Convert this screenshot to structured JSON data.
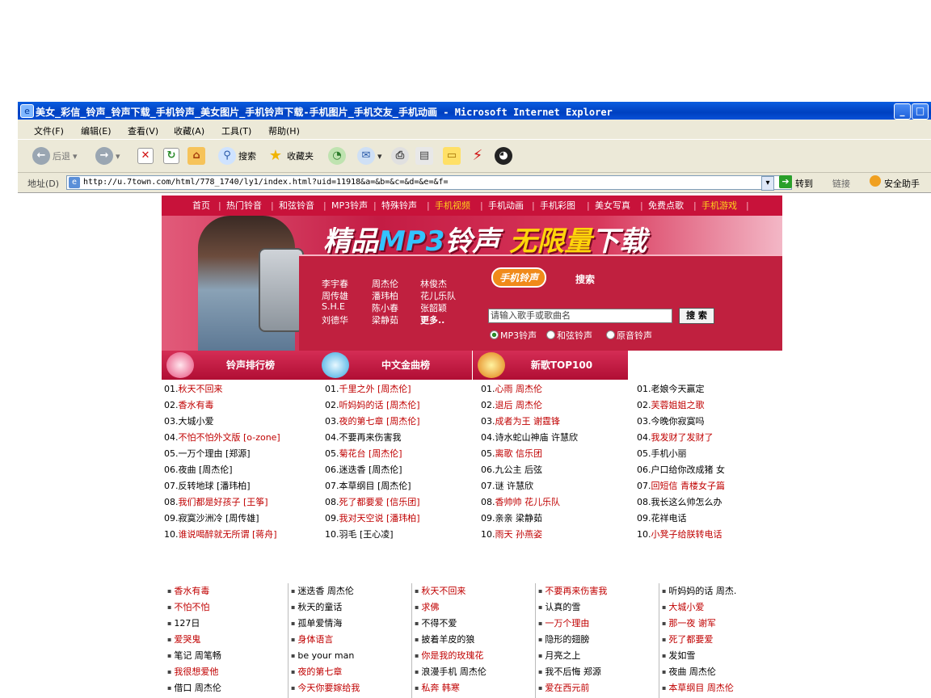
{
  "window": {
    "title": "美女_彩信_铃声_铃声下载_手机铃声_美女图片_手机铃声下载-手机图片_手机交友_手机动画 - Microsoft Internet Explorer"
  },
  "menu": [
    "文件(F)",
    "编辑(E)",
    "查看(V)",
    "收藏(A)",
    "工具(T)",
    "帮助(H)"
  ],
  "toolbar": {
    "back": "后退",
    "search": "搜索",
    "favorites": "收藏夹"
  },
  "address": {
    "label": "地址(D)",
    "url": "http://u.7town.com/html/778_1740/ly1/index.html?uid=11918&a=&b=&c=&d=&e=&f=",
    "go": "转到",
    "links": "链接",
    "assistant": "安全助手"
  },
  "nav": [
    {
      "label": "首页",
      "hl": false
    },
    {
      "label": "热门铃音",
      "hl": false
    },
    {
      "label": "和弦铃音",
      "hl": false
    },
    {
      "label": "MP3铃声",
      "hl": false
    },
    {
      "label": "特殊铃声",
      "hl": false
    },
    {
      "label": "手机视频",
      "hl": true
    },
    {
      "label": "手机动画",
      "hl": false
    },
    {
      "label": "手机彩图",
      "hl": false
    },
    {
      "label": "美女写真",
      "hl": false
    },
    {
      "label": "免费点歌",
      "hl": false
    },
    {
      "label": "手机游戏",
      "hl": true
    }
  ],
  "banner": {
    "headline_a": "精品",
    "headline_b": "MP3",
    "headline_c": "铃声",
    "headline_d": "无限量",
    "headline_e": "下载",
    "search_badge": "手机铃声",
    "search_word": "搜索",
    "search_placeholder": "请输入歌手或歌曲名",
    "search_button": "搜 索",
    "radio": [
      "MP3铃声",
      "和弦铃声",
      "原音铃声"
    ],
    "singers": [
      [
        "李宇春",
        "周杰伦",
        "林俊杰"
      ],
      [
        "周传雄",
        "潘玮柏",
        "花儿乐队"
      ],
      [
        "S.H.E",
        "陈小春",
        "张韶颖"
      ],
      [
        "刘德华",
        "梁静茹",
        "更多.."
      ]
    ]
  },
  "sections": [
    "铃声排行榜",
    "中文金曲榜",
    "新歌TOP100"
  ],
  "lists": [
    [
      {
        "t": "01.",
        "s": "秋天不回来",
        "r": true
      },
      {
        "t": "02.",
        "s": "香水有毒",
        "r": true
      },
      {
        "t": "03.",
        "s": "大城小爱",
        "r": false
      },
      {
        "t": "04.",
        "s": "不怕不怕外文版 [o-zone]",
        "r": true
      },
      {
        "t": "05.",
        "s": "一万个理由 [郑源]",
        "r": false
      },
      {
        "t": "06.",
        "s": "夜曲 [周杰伦]",
        "r": false
      },
      {
        "t": "07.",
        "s": "反转地球 [潘玮柏]",
        "r": false
      },
      {
        "t": "08.",
        "s": "我们都是好孩子 [王筝]",
        "r": true
      },
      {
        "t": "09.",
        "s": "寂寞沙洲冷 [周传雄]",
        "r": false
      },
      {
        "t": "10.",
        "s": "谁说喝醉就无所谓 [蒋舟]",
        "r": true
      }
    ],
    [
      {
        "t": "01.",
        "s": "千里之外 [周杰伦]",
        "r": true
      },
      {
        "t": "02.",
        "s": "听妈妈的话 [周杰伦]",
        "r": true
      },
      {
        "t": "03.",
        "s": "夜的第七章 [周杰伦]",
        "r": true
      },
      {
        "t": "04.",
        "s": "不要再来伤害我",
        "r": false
      },
      {
        "t": "05.",
        "s": "菊花台 [周杰伦]",
        "r": true
      },
      {
        "t": "06.",
        "s": "迷迭香 [周杰伦]",
        "r": false
      },
      {
        "t": "07.",
        "s": "本草纲目 [周杰伦]",
        "r": false
      },
      {
        "t": "08.",
        "s": "死了都要爱 [信乐团]",
        "r": true
      },
      {
        "t": "09.",
        "s": "我对天空说 [潘玮柏]",
        "r": true
      },
      {
        "t": "10.",
        "s": "羽毛 [王心凌]",
        "r": false
      }
    ],
    [
      {
        "t": "01.",
        "s": "心雨 周杰伦",
        "r": true
      },
      {
        "t": "02.",
        "s": "退后 周杰伦",
        "r": true
      },
      {
        "t": "03.",
        "s": "成者为王 谢霆锋",
        "r": true
      },
      {
        "t": "04.",
        "s": "诗水蛇山神庙 许慧欣",
        "r": false
      },
      {
        "t": "05.",
        "s": "离歌 信乐团",
        "r": true
      },
      {
        "t": "06.",
        "s": "九公主 后弦",
        "r": false
      },
      {
        "t": "07.",
        "s": "谜 许慧欣",
        "r": false
      },
      {
        "t": "08.",
        "s": "香帅帅 花儿乐队",
        "r": true
      },
      {
        "t": "09.",
        "s": "亲亲 梁静茹",
        "r": false
      },
      {
        "t": "10.",
        "s": "雨天 孙燕姿",
        "r": true
      }
    ],
    [
      {
        "t": "01.",
        "s": "老娘今天赢定",
        "r": false
      },
      {
        "t": "02.",
        "s": "芙蓉姐姐之歌",
        "r": true
      },
      {
        "t": "03.",
        "s": "今晚你寂寞吗",
        "r": false
      },
      {
        "t": "04.",
        "s": "我发财了发财了",
        "r": true
      },
      {
        "t": "05.",
        "s": "手机小丽",
        "r": false
      },
      {
        "t": "06.",
        "s": "户口给你改成猪 女",
        "r": false
      },
      {
        "t": "07.",
        "s": "回短信 青楼女子篇",
        "r": true
      },
      {
        "t": "08.",
        "s": "我长这么帅怎么办",
        "r": false
      },
      {
        "t": "09.",
        "s": "花祥电话",
        "r": false
      },
      {
        "t": "10.",
        "s": "小凳子给朕转电话",
        "r": true
      }
    ]
  ],
  "grid": [
    [
      {
        "s": "香水有毒",
        "r": true
      },
      {
        "s": "不怕不怕",
        "r": true
      },
      {
        "s": "127日",
        "r": false
      },
      {
        "s": "爱哭鬼",
        "r": true
      },
      {
        "s": "笔记 周笔畅",
        "r": false
      },
      {
        "s": "我很想爱他",
        "r": true
      },
      {
        "s": "借口 周杰伦",
        "r": false
      }
    ],
    [
      {
        "s": "迷迭香 周杰伦",
        "r": false
      },
      {
        "s": "秋天的童话",
        "r": false
      },
      {
        "s": "孤单爱情海",
        "r": false
      },
      {
        "s": "身体语言",
        "r": true
      },
      {
        "s": "be your man",
        "r": false
      },
      {
        "s": "夜的第七章",
        "r": true
      },
      {
        "s": "今天你要嫁给我",
        "r": true
      }
    ],
    [
      {
        "s": "秋天不回来",
        "r": true
      },
      {
        "s": "求佛",
        "r": true
      },
      {
        "s": "不得不爱",
        "r": false
      },
      {
        "s": "披着羊皮的狼",
        "r": false
      },
      {
        "s": "你是我的玫瑰花",
        "r": true
      },
      {
        "s": "浪漫手机 周杰伦",
        "r": false
      },
      {
        "s": "私奔 韩寒",
        "r": true
      }
    ],
    [
      {
        "s": "不要再来伤害我",
        "r": true
      },
      {
        "s": "认真的雪",
        "r": false
      },
      {
        "s": "一万个理由",
        "r": true
      },
      {
        "s": "隐形的翅膀",
        "r": false
      },
      {
        "s": "月亮之上",
        "r": false
      },
      {
        "s": "我不后悔 郑源",
        "r": false
      },
      {
        "s": "爱在西元前",
        "r": true
      }
    ],
    [
      {
        "s": "听妈妈的话 周杰.",
        "r": false
      },
      {
        "s": "大城小爱",
        "r": true
      },
      {
        "s": "那一夜 谢军",
        "r": true
      },
      {
        "s": "死了都要爱",
        "r": true
      },
      {
        "s": "发如雪",
        "r": false
      },
      {
        "s": "夜曲 周杰伦",
        "r": false
      },
      {
        "s": "本草纲目 周杰伦",
        "r": true
      }
    ]
  ]
}
